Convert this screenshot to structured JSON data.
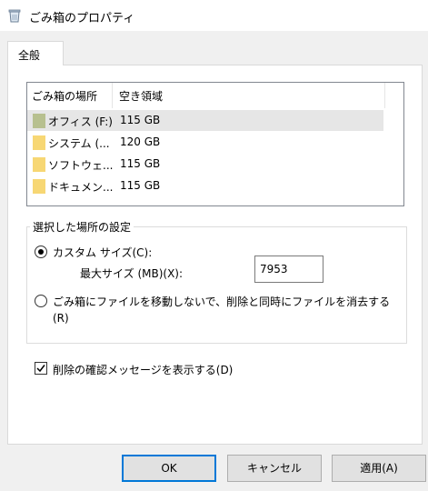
{
  "window": {
    "title": "ごみ箱のプロパティ",
    "icon": "recycle-bin-icon"
  },
  "tabs": [
    {
      "label": "全般",
      "selected": true
    }
  ],
  "location_list": {
    "columns": [
      "ごみ箱の場所",
      "空き領域"
    ],
    "rows": [
      {
        "name": "オフィス (F:)",
        "free_space": "115 GB",
        "selected": true
      },
      {
        "name": "システム (...",
        "free_space": "120 GB",
        "selected": false
      },
      {
        "name": "ソフトウェ...",
        "free_space": "115 GB",
        "selected": false
      },
      {
        "name": "ドキュメン...",
        "free_space": "115 GB",
        "selected": false
      }
    ]
  },
  "settings": {
    "group_label": "選択した場所の設定",
    "custom_size": {
      "label": "カスタム サイズ(C):",
      "checked": true
    },
    "max_size": {
      "label": "最大サイズ (MB)(X):",
      "value": "7953"
    },
    "no_recycle": {
      "label_line1": "ごみ箱にファイルを移動しないで、削除と同時にファイルを消去する",
      "label_line2": "(R)",
      "checked": false
    }
  },
  "confirm_delete": {
    "label": "削除の確認メッセージを表示する(D)",
    "checked": true
  },
  "buttons": {
    "ok": "OK",
    "cancel": "キャンセル",
    "apply": "適用(A)"
  },
  "colors": {
    "folder": "#f7d774",
    "folder_selected": "#b7c08f",
    "accent": "#0078d7"
  }
}
